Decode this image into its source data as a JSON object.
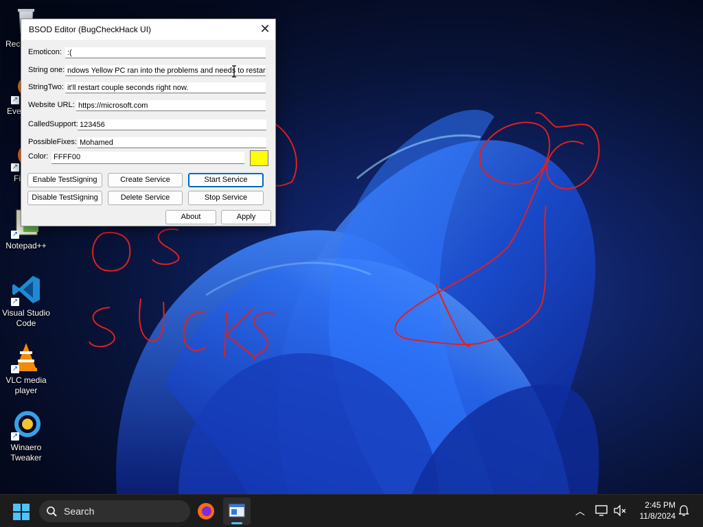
{
  "desktop": {
    "icons": [
      {
        "label": "Recy",
        "icon": "recycle-bin-icon"
      },
      {
        "label": "Ever",
        "icon": "everything-icon"
      },
      {
        "label": "Fir",
        "icon": "firefox-icon"
      },
      {
        "label": "Notepad++",
        "icon": "notepad-plus-plus-icon"
      },
      {
        "label": "Visual Studio Code",
        "icon": "vscode-icon"
      },
      {
        "label": "VLC media player",
        "icon": "vlc-icon"
      },
      {
        "label": "Winaero Tweaker",
        "icon": "winaero-tweaker-icon"
      }
    ],
    "scribble_color": "#e02020"
  },
  "window": {
    "title": "BSOD Editor (BugCheckHack UI)",
    "close_glyph": "✕",
    "fields": {
      "emoticon": {
        "label": "Emoticon:",
        "value": ":("
      },
      "string_one": {
        "label": "String one:",
        "value": "ndows Yellow PC ran into the problems and needs to restart."
      },
      "string_two": {
        "label": "StringTwo:",
        "value": "it'll restart couple seconds right now."
      },
      "website_url": {
        "label": "Website URL:",
        "value": "https://microsoft.com"
      },
      "called_support": {
        "label": "CalledSupport:",
        "value": "123456"
      },
      "possible_fixes": {
        "label": "PossibleFixes:",
        "value": "Mohamed"
      },
      "color": {
        "label": "Color:",
        "value": "FFFF00",
        "swatch": "#ffff00"
      }
    },
    "buttons": {
      "enable_test_signing": "Enable TestSigning",
      "create_service": "Create Service",
      "start_service": "Start Service",
      "disable_test_signing": "Disable TestSigning",
      "delete_service": "Delete Service",
      "stop_service": "Stop Service",
      "about": "About",
      "apply": "Apply"
    }
  },
  "taskbar": {
    "search_label": "Search",
    "clock_time": "2:45 PM",
    "clock_date": "11/8/2024",
    "background": "#1c1c1c"
  }
}
